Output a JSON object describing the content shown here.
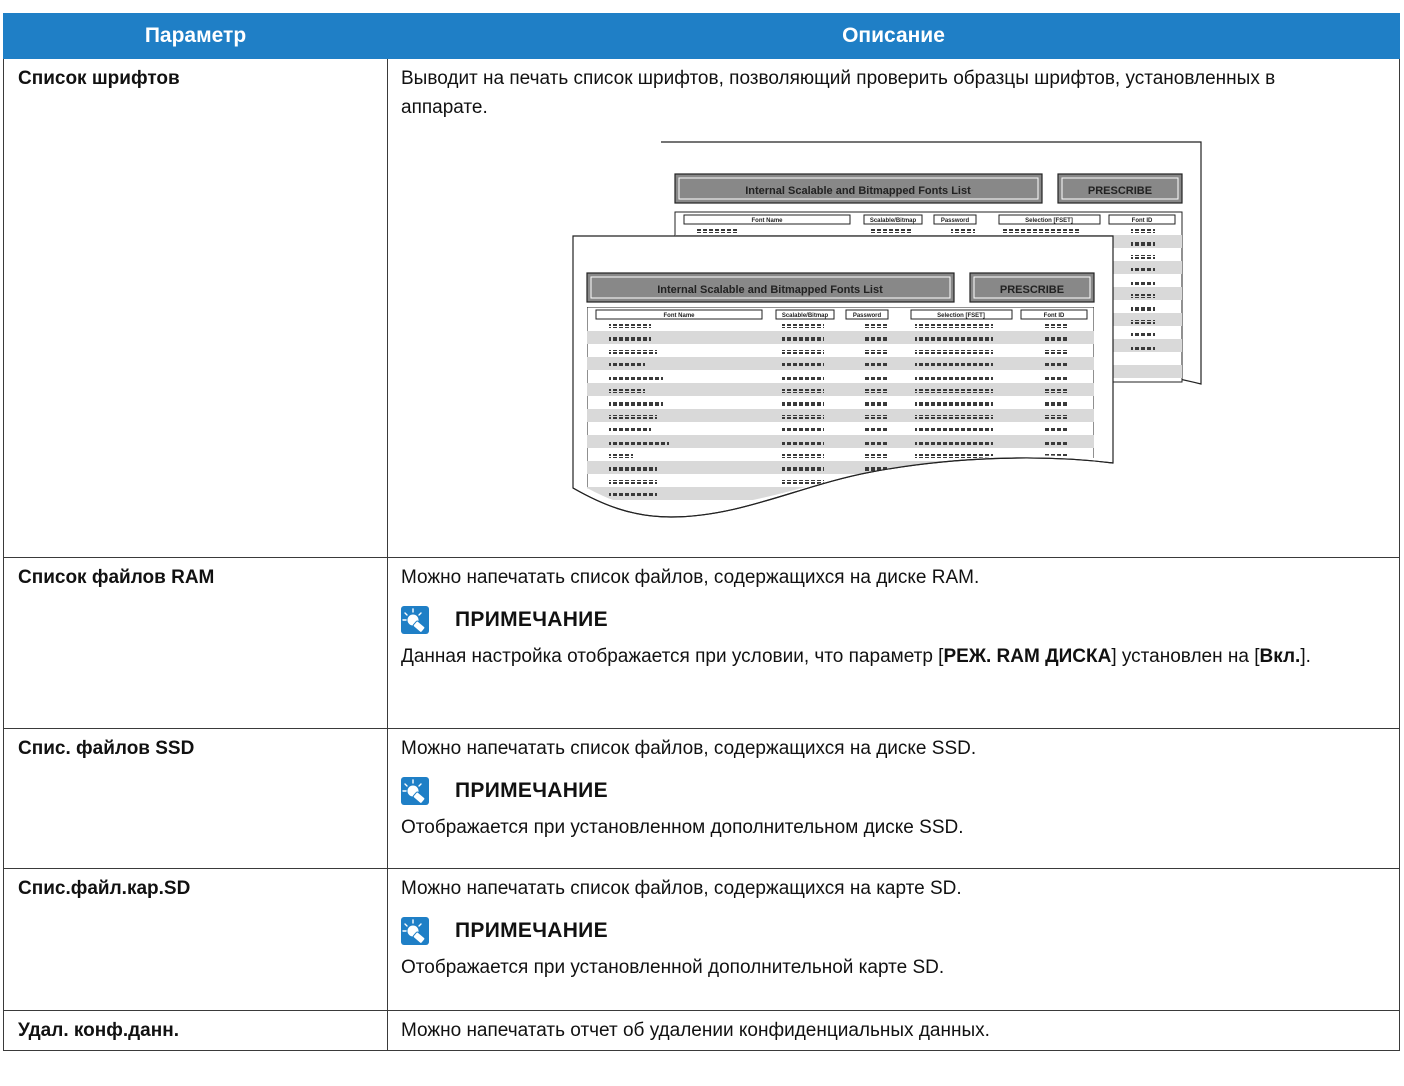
{
  "table": {
    "headers": {
      "param": "Параметр",
      "desc": "Описание"
    },
    "rows": [
      {
        "param": "Список шрифтов",
        "text": "Выводит на печать список шрифтов, позволяющий проверить образцы шрифтов, установленных в аппарате.",
        "figure": {
          "title": "Internal Scalable and Bitmapped Fonts List",
          "brand": "PRESCRIBE",
          "columns": [
            "Font Name",
            "Scalable/Bitmap",
            "Password",
            "Selection     [FSET]",
            "Font ID"
          ]
        }
      },
      {
        "param": "Список файлов RAM",
        "text": "Можно напечатать список файлов, содержащихся на диске RAM.",
        "note_title": "ПРИМЕЧАНИЕ",
        "note_parts": [
          "Данная настройка отображается при условии, что параметр [",
          "РЕЖ. RAM ДИСКА",
          "] установлен на [",
          "Вкл.",
          "]."
        ]
      },
      {
        "param": "Спис. файлов SSD",
        "text": "Можно напечатать список файлов, содержащихся на диске SSD.",
        "note_title": "ПРИМЕЧАНИЕ",
        "note": "Отображается при установленном дополнительном диске SSD."
      },
      {
        "param": "Спис.файл.кар.SD",
        "text": "Можно напечатать список файлов, содержащихся на карте SD.",
        "note_title": "ПРИМЕЧАНИЕ",
        "note": "Отображается при установленной дополнительной карте SD."
      },
      {
        "param": "Удал. конф.данн.",
        "text": "Можно напечатать отчет об удалении конфиденциальных данных."
      }
    ]
  },
  "colors": {
    "header_bg": "#1f7fc6",
    "header_text": "#ffffff",
    "border": "#3a3a3a"
  }
}
